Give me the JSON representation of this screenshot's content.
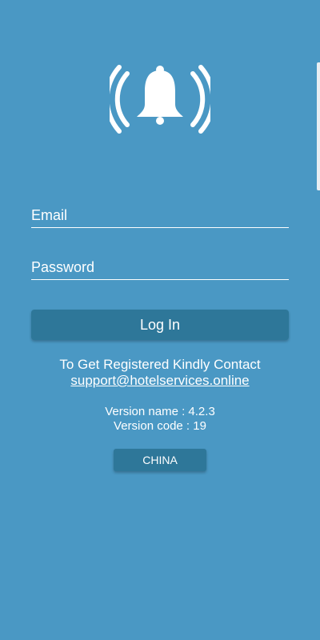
{
  "app": {
    "logo_icon": "bell-with-signal-waves-icon",
    "background_color": "#4a98c4",
    "button_color": "#2e7799"
  },
  "form": {
    "email_placeholder": "Email",
    "password_placeholder": "Password",
    "login_label": "Log In"
  },
  "contact": {
    "message": "To Get Registered Kindly Contact",
    "email": "support@hotelservices.online"
  },
  "version": {
    "name_text": "Version name : 4.2.3",
    "code_text": "Version code : 19"
  },
  "country": {
    "label": "CHINA"
  }
}
